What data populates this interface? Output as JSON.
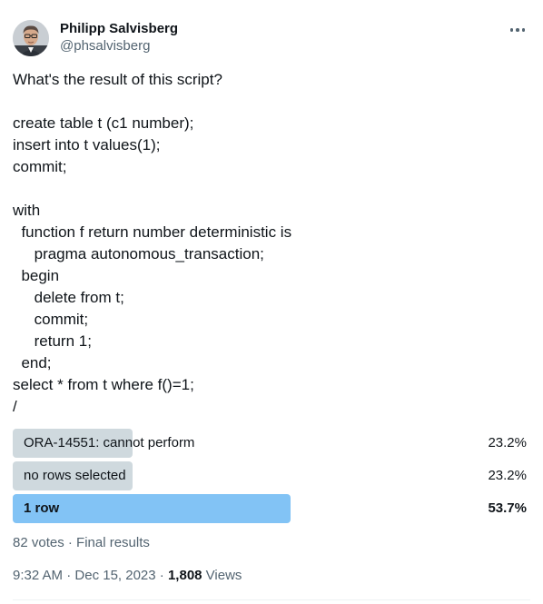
{
  "author": {
    "display_name": "Philipp Salvisberg",
    "handle": "@phsalvisberg"
  },
  "tweet": {
    "lines": [
      "What's the result of this script?",
      "",
      "create table t (c1 number);",
      "insert into t values(1);",
      "commit;",
      "",
      "with",
      "  function f return number deterministic is",
      "     pragma autonomous_transaction;",
      "  begin",
      "     delete from t;",
      "     commit;",
      "     return 1;",
      "  end;",
      "select * from t where f()=1;",
      "/"
    ]
  },
  "poll": {
    "options": [
      {
        "label": "ORA-14551: cannot perform",
        "percent_text": "23.2%",
        "percent": 23.2,
        "winner": false
      },
      {
        "label": "no rows selected",
        "percent_text": "23.2%",
        "percent": 23.2,
        "winner": false
      },
      {
        "label": "1 row",
        "percent_text": "53.7%",
        "percent": 53.7,
        "winner": true
      }
    ],
    "meta": "82 votes · Final results"
  },
  "meta": {
    "time": "9:32 AM",
    "sep1": " · ",
    "date": "Dec 15, 2023",
    "sep2": " · ",
    "views_count": "1,808",
    "views_label": " Views"
  },
  "colors": {
    "bar_default": "#cfd9de",
    "bar_winner": "#82c3f5",
    "secondary_text": "#536471"
  },
  "icons": {
    "more": "more-horizontal-icon",
    "avatar": "user-avatar"
  }
}
